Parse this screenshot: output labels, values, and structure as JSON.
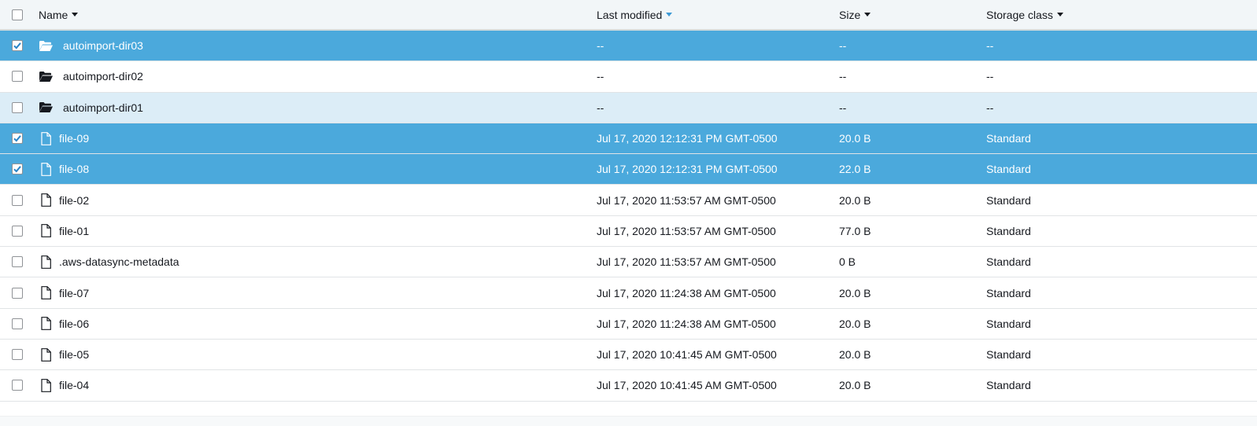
{
  "header": {
    "name": "Name",
    "last_modified": "Last modified",
    "size": "Size",
    "storage_class": "Storage class"
  },
  "colors": {
    "selected": "#4ba9dc",
    "hover": "#dcedf7",
    "sort_active": "#3d9ad6"
  },
  "rows": [
    {
      "type": "folder",
      "name": "autoimport-dir03",
      "modified": "--",
      "size": "--",
      "class": "--",
      "checked": true,
      "state": "sel"
    },
    {
      "type": "folder",
      "name": "autoimport-dir02",
      "modified": "--",
      "size": "--",
      "class": "--",
      "checked": false,
      "state": ""
    },
    {
      "type": "folder",
      "name": "autoimport-dir01",
      "modified": "--",
      "size": "--",
      "class": "--",
      "checked": false,
      "state": "hover"
    },
    {
      "type": "file",
      "name": "file-09",
      "modified": "Jul 17, 2020 12:12:31 PM GMT-0500",
      "size": "20.0 B",
      "class": "Standard",
      "checked": true,
      "state": "sel"
    },
    {
      "type": "file",
      "name": "file-08",
      "modified": "Jul 17, 2020 12:12:31 PM GMT-0500",
      "size": "22.0 B",
      "class": "Standard",
      "checked": true,
      "state": "sel"
    },
    {
      "type": "file",
      "name": "file-02",
      "modified": "Jul 17, 2020 11:53:57 AM GMT-0500",
      "size": "20.0 B",
      "class": "Standard",
      "checked": false,
      "state": ""
    },
    {
      "type": "file",
      "name": "file-01",
      "modified": "Jul 17, 2020 11:53:57 AM GMT-0500",
      "size": "77.0 B",
      "class": "Standard",
      "checked": false,
      "state": ""
    },
    {
      "type": "file",
      "name": ".aws-datasync-metadata",
      "modified": "Jul 17, 2020 11:53:57 AM GMT-0500",
      "size": "0 B",
      "class": "Standard",
      "checked": false,
      "state": ""
    },
    {
      "type": "file",
      "name": "file-07",
      "modified": "Jul 17, 2020 11:24:38 AM GMT-0500",
      "size": "20.0 B",
      "class": "Standard",
      "checked": false,
      "state": ""
    },
    {
      "type": "file",
      "name": "file-06",
      "modified": "Jul 17, 2020 11:24:38 AM GMT-0500",
      "size": "20.0 B",
      "class": "Standard",
      "checked": false,
      "state": ""
    },
    {
      "type": "file",
      "name": "file-05",
      "modified": "Jul 17, 2020 10:41:45 AM GMT-0500",
      "size": "20.0 B",
      "class": "Standard",
      "checked": false,
      "state": ""
    },
    {
      "type": "file",
      "name": "file-04",
      "modified": "Jul 17, 2020 10:41:45 AM GMT-0500",
      "size": "20.0 B",
      "class": "Standard",
      "checked": false,
      "state": ""
    }
  ]
}
